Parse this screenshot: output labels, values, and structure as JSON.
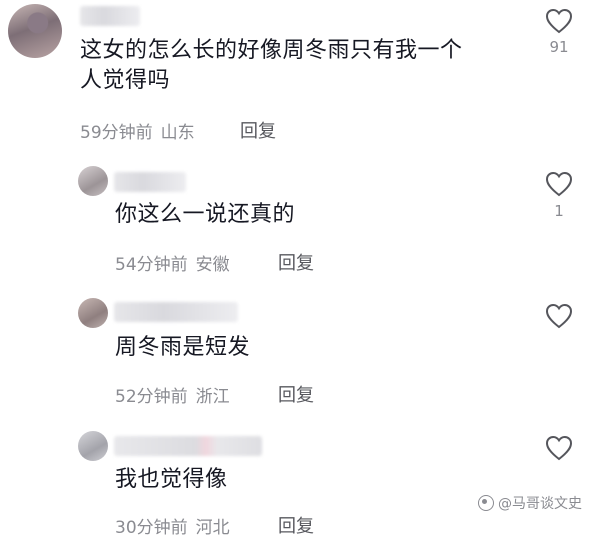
{
  "comments": [
    {
      "text_line1": "这女的怎么长的好像周冬雨只有我一个",
      "text_line2": "人觉得吗",
      "time": "59分钟前",
      "location": "山东",
      "reply_label": "回复",
      "likes": "91"
    },
    {
      "text": "你这么一说还真的",
      "time": "54分钟前",
      "location": "安徽",
      "reply_label": "回复",
      "likes": "1"
    },
    {
      "text": "周冬雨是短发",
      "time": "52分钟前",
      "location": "浙江",
      "reply_label": "回复",
      "likes": ""
    },
    {
      "text": "我也觉得像",
      "time": "30分钟前",
      "location": "河北",
      "reply_label": "回复",
      "likes": ""
    }
  ],
  "watermark": "@马哥谈文史",
  "icons": {
    "like": "heart-outline-icon",
    "watermark": "watermark-logo-icon"
  },
  "colors": {
    "text": "#161823",
    "meta": "#8a8b91"
  }
}
